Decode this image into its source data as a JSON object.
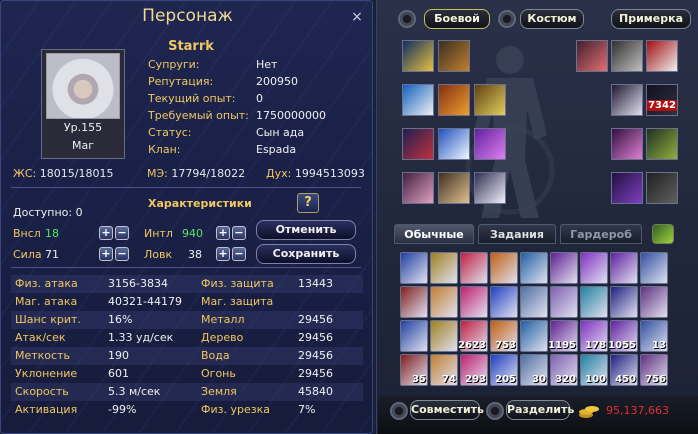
{
  "character_window": {
    "title": "Персонаж",
    "close_label": "×",
    "name": "Starrk",
    "level": "Ур.155",
    "class": "Маг",
    "info": [
      {
        "key": "Супруги:",
        "value": "Нет"
      },
      {
        "key": "Репутация:",
        "value": "200950"
      },
      {
        "key": "Текущий опыт:",
        "value": "0"
      },
      {
        "key": "Требуемый опыт:",
        "value": "1750000000"
      },
      {
        "key": "Статус:",
        "value": "Сын ада"
      },
      {
        "key": "Клан:",
        "value": "Espada"
      }
    ],
    "hp_label": "ЖС:",
    "hp_value": "18015/18015",
    "mp_label": "МЭ:",
    "mp_value": "17794/18022",
    "soul_label": "Дух:",
    "soul_value": "1994513093",
    "chars_title": "Характеристики",
    "help_label": "?",
    "available_label": "Доступно:",
    "available_value": "0",
    "attributes": [
      {
        "key": "Внсл",
        "value": "18"
      },
      {
        "key": "Сила",
        "value": "71"
      },
      {
        "key": "Интл",
        "value": "940"
      },
      {
        "key": "Ловк",
        "value": "38"
      }
    ],
    "plus": "+",
    "minus": "−",
    "cancel_label": "Отменить",
    "save_label": "Сохранить",
    "stats": [
      {
        "k1": "Физ. атака",
        "v1": "3156-3834",
        "k2": "Физ. защита",
        "v2": "13443"
      },
      {
        "k1": "Маг. атака",
        "v1": "40321-44179",
        "k2": "Маг. защита",
        "v2": ""
      },
      {
        "k1": "Шанс крит.",
        "v1": "16%",
        "k2": "Металл",
        "v2": "29456"
      },
      {
        "k1": "Атак/сек",
        "v1": "1.33 уд/сек",
        "k2": "Дерево",
        "v2": "29456"
      },
      {
        "k1": "Меткость",
        "v1": "190",
        "k2": "Вода",
        "v2": "29456"
      },
      {
        "k1": "Уклонение",
        "v1": "601",
        "k2": "Огонь",
        "v2": "29456"
      },
      {
        "k1": "Скорость",
        "v1": "5.3 м/сек",
        "k2": "Земля",
        "v2": "45840"
      },
      {
        "k1": "Активация",
        "v1": "-99%",
        "k2": "Физ. урезка",
        "v2": "7%"
      }
    ]
  },
  "equipment_panel": {
    "mode_tabs": [
      "Боевой",
      "Костюм"
    ],
    "preview_label": "Примерка",
    "badge_value": "7342",
    "inventory_tabs": [
      "Обычные",
      "Задания",
      "Гардероб"
    ],
    "item_counts": [
      {
        "row": 3,
        "col": 3,
        "text": "2623"
      },
      {
        "row": 3,
        "col": 4,
        "text": "753"
      },
      {
        "row": 3,
        "col": 6,
        "text": "1195"
      },
      {
        "row": 3,
        "col": 7,
        "text": "178"
      },
      {
        "row": 3,
        "col": 8,
        "text": "1055"
      },
      {
        "row": 3,
        "col": 9,
        "text": "13"
      },
      {
        "row": 4,
        "col": 1,
        "text": "35"
      },
      {
        "row": 4,
        "col": 2,
        "text": "74"
      },
      {
        "row": 4,
        "col": 3,
        "text": "293"
      },
      {
        "row": 4,
        "col": 4,
        "text": "205"
      },
      {
        "row": 4,
        "col": 5,
        "text": "30"
      },
      {
        "row": 4,
        "col": 6,
        "text": "320"
      },
      {
        "row": 4,
        "col": 7,
        "text": "100"
      },
      {
        "row": 4,
        "col": 8,
        "text": "450"
      },
      {
        "row": 4,
        "col": 9,
        "text": "756"
      }
    ],
    "combine_label": "Совместить",
    "split_label": "Разделить",
    "money": "95,137,663"
  }
}
